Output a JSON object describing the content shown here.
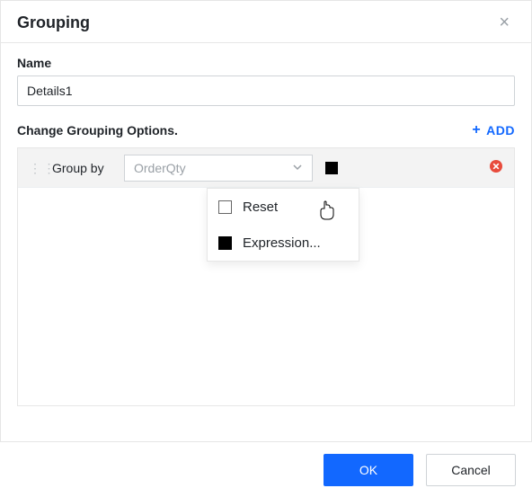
{
  "dialog": {
    "title": "Grouping"
  },
  "nameField": {
    "label": "Name",
    "value": "Details1"
  },
  "section": {
    "title": "Change Grouping Options.",
    "addLabel": "ADD"
  },
  "row": {
    "label": "Group by",
    "dropdownValue": "OrderQty",
    "swatchColor": "#000000"
  },
  "popup": {
    "items": [
      {
        "swatch": "white",
        "label": "Reset"
      },
      {
        "swatch": "black",
        "label": "Expression..."
      }
    ]
  },
  "footer": {
    "ok": "OK",
    "cancel": "Cancel"
  }
}
